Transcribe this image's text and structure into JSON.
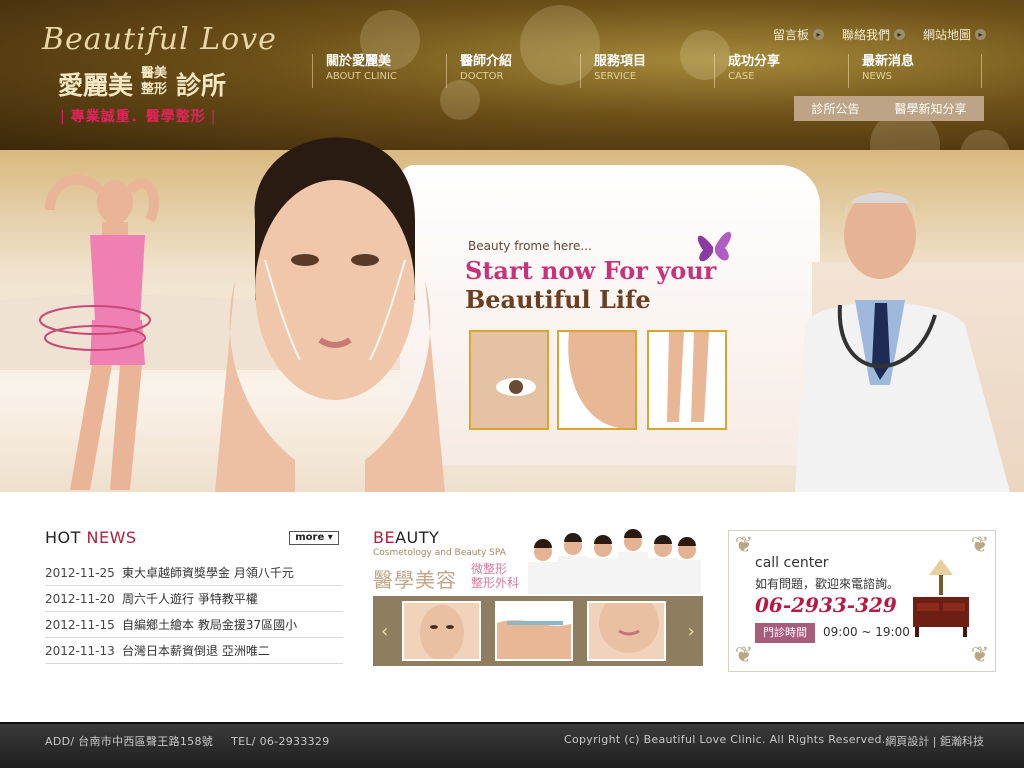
{
  "brand": {
    "script": "Beautiful Love",
    "name_a": "愛麗美",
    "name_sub": "醫美整形",
    "name_b": "診所",
    "tagline": "專業誠重．醫學整形"
  },
  "toplinks": [
    {
      "label": "留言板"
    },
    {
      "label": "聯絡我們"
    },
    {
      "label": "網站地圖"
    }
  ],
  "nav": [
    {
      "cn": "關於愛麗美",
      "en": "ABOUT CLINIC"
    },
    {
      "cn": "醫師介紹",
      "en": "DOCTOR"
    },
    {
      "cn": "服務項目",
      "en": "SERVICE"
    },
    {
      "cn": "成功分享",
      "en": "CASE"
    },
    {
      "cn": "最新消息",
      "en": "NEWS"
    }
  ],
  "subnav": [
    {
      "label": "診所公告"
    },
    {
      "label": "醫學新知分享"
    }
  ],
  "banner": {
    "small": "Beauty frome here...",
    "line1": "Start now For your",
    "line2": "Beautiful Life"
  },
  "hot": {
    "title_a": "HOT ",
    "title_b": "NEWS",
    "more": "more",
    "items": [
      {
        "date": "2012-11-25",
        "text": "東大卓越師資獎學金 月領八千元"
      },
      {
        "date": "2012-11-20",
        "text": "周六千人遊行 爭特教平權"
      },
      {
        "date": "2012-11-15",
        "text": "自編鄉土繪本 教局金援37區國小"
      },
      {
        "date": "2012-11-13",
        "text": "台灣日本薪資倒退 亞洲唯二"
      }
    ]
  },
  "beauty": {
    "title_a": "BE",
    "title_b": "AUTY",
    "sub": "Cosmetology and Beauty SPA",
    "cn": "醫學美容",
    "cn2a": "微整形",
    "cn2b": "整形外科",
    "prev": "‹",
    "next": "›"
  },
  "call": {
    "title": "call center",
    "desc": "如有問題，歡迎來電諮詢。",
    "phone": "06-2933-329",
    "hours_label": "門診時間",
    "hours": "09:00 ~ 19:00"
  },
  "footer": {
    "addr": "ADD/ 台南市中西區聲王路158號",
    "tel": "TEL/ 06-2933329",
    "copy": "Copyright (c) Beautiful Love Clinic. All Rights Reserved.",
    "design": "網頁設計",
    "sep": "|",
    "company": "鉅瀚科技"
  },
  "colors": {
    "accent": "#b21f3a",
    "gold": "#d6a630",
    "header": "#6d5018"
  }
}
